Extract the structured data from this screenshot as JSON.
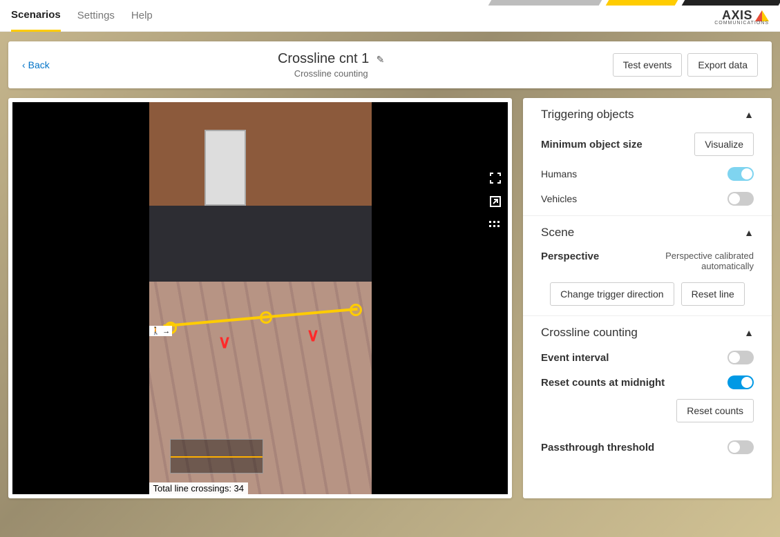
{
  "brand": {
    "name": "AXIS",
    "sub": "COMMUNICATIONS"
  },
  "tabs": {
    "scenarios": "Scenarios",
    "settings": "Settings",
    "help": "Help",
    "active": "scenarios"
  },
  "header": {
    "back": "Back",
    "title": "Crossline cnt 1",
    "subtitle": "Crossline counting",
    "test_events": "Test events",
    "export_data": "Export data"
  },
  "video": {
    "total_crossings_label": "Total line crossings: 34",
    "pedestrian_icon_text": "🚶 →"
  },
  "panel": {
    "triggering": {
      "title": "Triggering objects",
      "min_size_label": "Minimum object size",
      "visualize": "Visualize",
      "humans_label": "Humans",
      "humans_on": true,
      "vehicles_label": "Vehicles",
      "vehicles_on": false
    },
    "scene": {
      "title": "Scene",
      "perspective_label": "Perspective",
      "perspective_value": "Perspective calibrated automatically",
      "change_dir": "Change trigger direction",
      "reset_line": "Reset line"
    },
    "counting": {
      "title": "Crossline counting",
      "event_interval_label": "Event interval",
      "event_interval_on": false,
      "reset_midnight_label": "Reset counts at midnight",
      "reset_midnight_on": true,
      "reset_counts": "Reset counts",
      "passthrough_label": "Passthrough threshold",
      "passthrough_on": false
    }
  }
}
